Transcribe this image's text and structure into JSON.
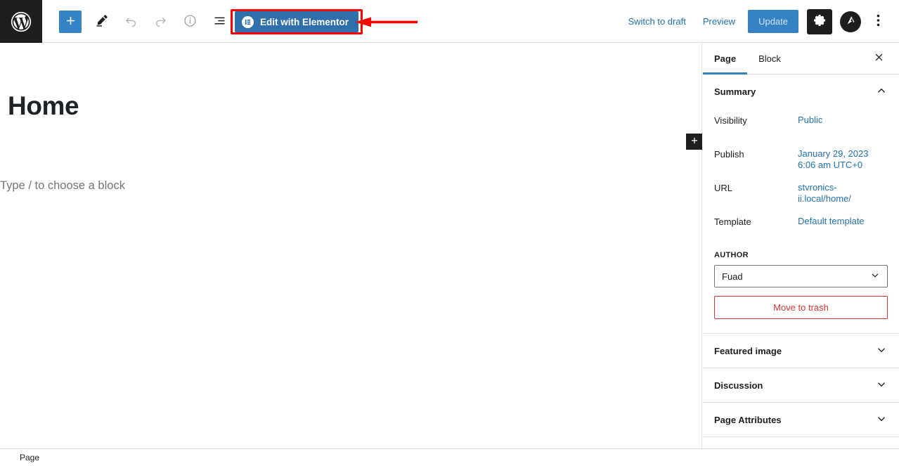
{
  "topbar": {
    "wp_logo_title": "WordPress",
    "tools": [
      {
        "name": "block-inserter-toggle",
        "icon": "plus-icon",
        "label": "Toggle block inserter"
      },
      {
        "name": "tools-edit",
        "icon": "pencil-icon",
        "label": "Tools"
      },
      {
        "name": "undo",
        "icon": "undo-icon",
        "label": "Undo"
      },
      {
        "name": "redo",
        "icon": "redo-icon",
        "label": "Redo"
      },
      {
        "name": "details",
        "icon": "info-icon",
        "label": "Details"
      },
      {
        "name": "list-view",
        "icon": "list-view-icon",
        "label": "List View"
      }
    ],
    "elementor_button": "Edit with Elementor",
    "elementor_badge": "E",
    "switch_to_draft": "Switch to draft",
    "preview": "Preview",
    "update": "Update",
    "settings_label": "Settings",
    "astra_label": "Astra",
    "options_label": "Options"
  },
  "annotation": {
    "arrow_color": "#fe0000",
    "highlight_color": "#fe0000",
    "target": "Edit with Elementor"
  },
  "editor": {
    "title": "Home",
    "block_placeholder": "Type / to choose a block",
    "inserter_label": "Add block"
  },
  "sidebar": {
    "tabs": [
      {
        "label": "Page",
        "active": true
      },
      {
        "label": "Block",
        "active": false
      }
    ],
    "close_label": "Close settings",
    "summary": {
      "title": "Summary",
      "rows": [
        {
          "label": "Visibility",
          "value": "Public"
        },
        {
          "label": "Publish",
          "value": "January 29, 2023 6:06 am UTC+0"
        },
        {
          "label": "URL",
          "value": "stvronics-ii.local/home/"
        },
        {
          "label": "Template",
          "value": "Default template"
        }
      ],
      "author_label": "AUTHOR",
      "author_value": "Fuad",
      "trash_label": "Move to trash"
    },
    "panels": [
      {
        "label": "Featured image"
      },
      {
        "label": "Discussion"
      },
      {
        "label": "Page Attributes"
      }
    ]
  },
  "bottombar": {
    "breadcrumb": "Page"
  },
  "colors": {
    "accent_blue": "#3582c4",
    "link_blue": "#2271b1",
    "danger_red": "#d63638",
    "annotation_red": "#fe0000",
    "dark": "#1e1e1e"
  }
}
